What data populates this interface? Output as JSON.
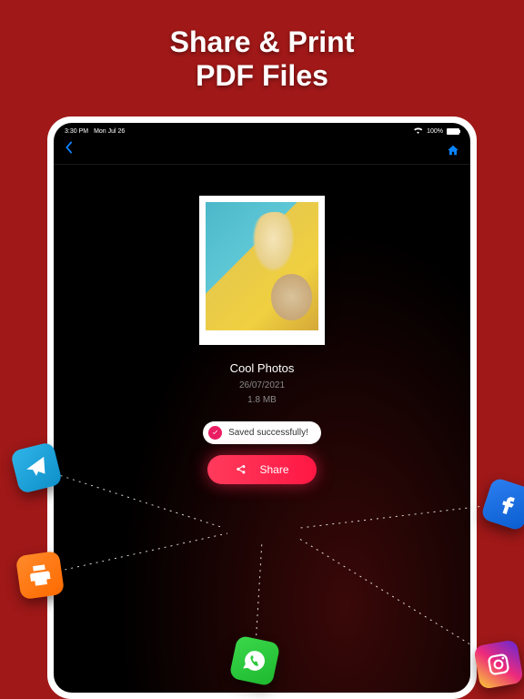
{
  "hero": {
    "line1": "Share & Print",
    "line2": "PDF Files"
  },
  "statusbar": {
    "time": "3:30 PM",
    "date": "Mon Jul 26",
    "battery": "100%"
  },
  "file": {
    "title": "Cool Photos",
    "date": "26/07/2021",
    "size": "1.8 MB"
  },
  "toast": {
    "text": "Saved successfully!"
  },
  "share": {
    "label": "Share"
  },
  "icons": {
    "telegram": "telegram",
    "facebook": "facebook",
    "printer": "printer",
    "whatsapp": "whatsapp",
    "instagram": "instagram"
  }
}
